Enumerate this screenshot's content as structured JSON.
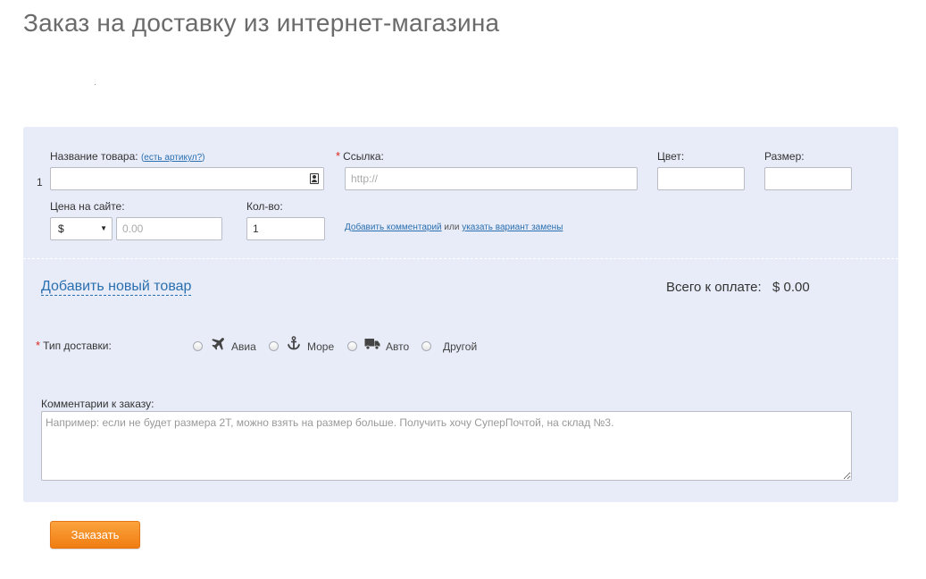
{
  "page": {
    "title": "Заказ на доставку из интернет-магазина"
  },
  "item": {
    "row_number": "1",
    "name_label": "Название товара:",
    "article_link_open": "(",
    "article_link": "есть артикул?",
    "article_link_close": ")",
    "url_label": "Ссылка:",
    "url_placeholder": "http://",
    "color_label": "Цвет:",
    "size_label": "Размер:",
    "price_label": "Цена на сайте:",
    "currency_selected": "$",
    "price_placeholder": "0.00",
    "qty_label": "Кол-во:",
    "qty_value": "1",
    "add_comment_link": "Добавить комментарий",
    "or_text": "или",
    "replacement_link": "указать вариант замены"
  },
  "add_item_link": "Добавить новый товар",
  "total": {
    "label": "Всего к оплате:",
    "value": "$ 0.00"
  },
  "delivery": {
    "required_mark": "*",
    "label": "Тип доставки:",
    "options": [
      {
        "label": "Авиа",
        "icon": "airplane-icon"
      },
      {
        "label": "Море",
        "icon": "anchor-icon"
      },
      {
        "label": "Авто",
        "icon": "truck-icon"
      },
      {
        "label": "Другой",
        "icon": ""
      }
    ]
  },
  "comments": {
    "label": "Комментарии к заказу:",
    "placeholder": "Например: если не будет размера 2T, можно взять на размер больше. Получить хочу СуперПочтой, на склад №3."
  },
  "submit_label": "Заказать",
  "colors": {
    "panel_bg": "#e8ecf8",
    "link": "#2a6fb0",
    "required": "#d9251d",
    "button_orange": "#f58a1f"
  }
}
